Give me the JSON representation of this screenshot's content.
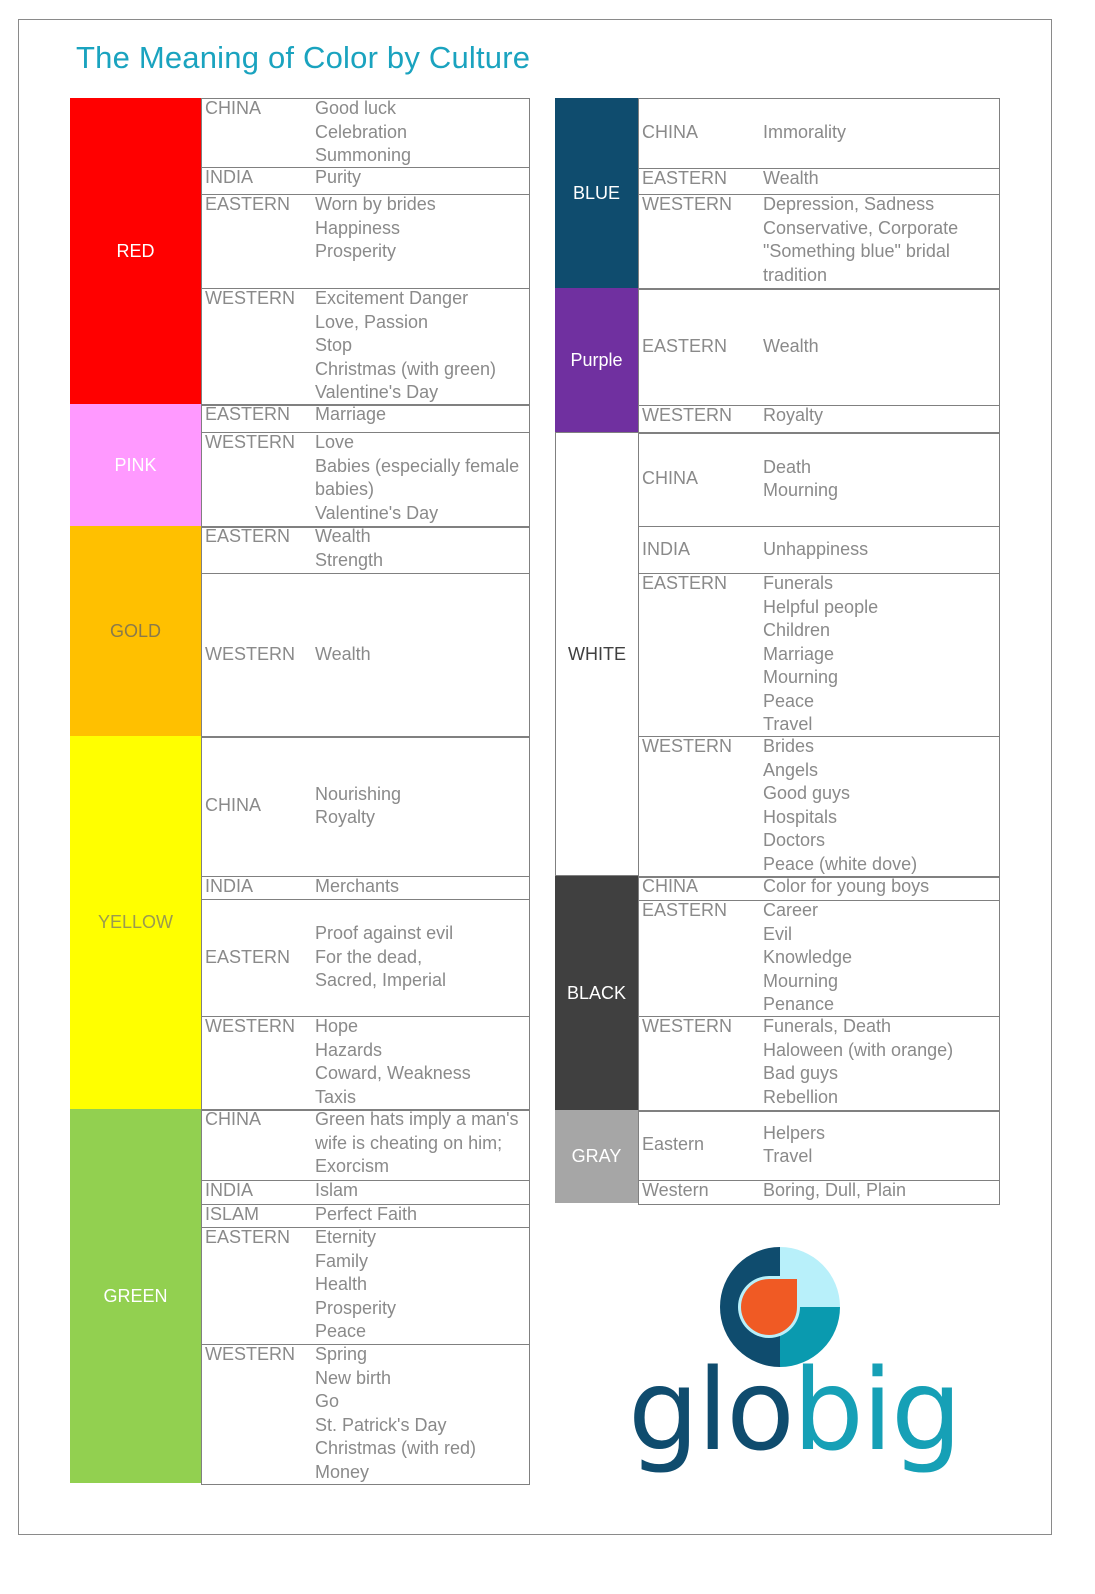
{
  "title": "The Meaning of Color by Culture",
  "colors": {
    "red": "#FF0000",
    "pink": "#FF99FF",
    "gold": "#FFC000",
    "yellow": "#FFFF00",
    "green": "#92D050",
    "blue": "#0F4C6E",
    "purple": "#7030A0",
    "white": "#FFFFFF",
    "black": "#404040",
    "gray": "#A6A6A6",
    "title": "#1AA3BF"
  },
  "left_table": [
    {
      "color": "RED",
      "rows": [
        {
          "region": "CHINA",
          "meanings": [
            "Good luck",
            "Celebration",
            "Summoning"
          ]
        },
        {
          "region": "INDIA",
          "meanings": [
            "Purity"
          ]
        },
        {
          "region": "EASTERN",
          "meanings": [
            "Worn by brides",
            "Happiness",
            "Prosperity"
          ]
        },
        {
          "region": "WESTERN",
          "meanings": [
            "Excitement Danger",
            "Love, Passion",
            "Stop",
            "Christmas (with green)",
            "Valentine's Day"
          ]
        }
      ]
    },
    {
      "color": "PINK",
      "rows": [
        {
          "region": "EASTERN",
          "meanings": [
            "Marriage"
          ]
        },
        {
          "region": "WESTERN",
          "meanings": [
            "Love",
            "Babies (especially female",
            "babies)",
            "Valentine's Day"
          ]
        }
      ]
    },
    {
      "color": "GOLD",
      "rows": [
        {
          "region": "EASTERN",
          "meanings": [
            "Wealth",
            "Strength"
          ]
        },
        {
          "region": "WESTERN",
          "meanings": [
            "Wealth"
          ]
        }
      ]
    },
    {
      "color": "YELLOW",
      "rows": [
        {
          "region": "CHINA",
          "meanings": [
            "Nourishing",
            "Royalty"
          ]
        },
        {
          "region": "INDIA",
          "meanings": [
            "Merchants"
          ]
        },
        {
          "region": "EASTERN",
          "meanings": [
            "Proof against evil",
            "For the dead,",
            "Sacred, Imperial"
          ]
        },
        {
          "region": "WESTERN",
          "meanings": [
            "Hope",
            "Hazards",
            "Coward, Weakness",
            "Taxis"
          ]
        }
      ]
    },
    {
      "color": "GREEN",
      "rows": [
        {
          "region": "CHINA",
          "meanings": [
            "Green hats imply a man's",
            "wife is cheating on him;",
            "Exorcism"
          ]
        },
        {
          "region": "INDIA",
          "meanings": [
            "Islam"
          ]
        },
        {
          "region": "ISLAM",
          "meanings": [
            "Perfect Faith"
          ]
        },
        {
          "region": "EASTERN",
          "meanings": [
            "Eternity",
            "Family",
            "Health",
            "Prosperity",
            "Peace"
          ]
        },
        {
          "region": "WESTERN",
          "meanings": [
            "Spring",
            "New birth",
            "Go",
            "St. Patrick's Day",
            "Christmas (with red)",
            "Money"
          ]
        }
      ]
    }
  ],
  "right_table": [
    {
      "color": "BLUE",
      "rows": [
        {
          "region": "CHINA",
          "meanings": [
            "Immorality"
          ]
        },
        {
          "region": "EASTERN",
          "meanings": [
            "Wealth"
          ]
        },
        {
          "region": "WESTERN",
          "meanings": [
            "Depression, Sadness",
            "Conservative, Corporate",
            "\"Something blue\" bridal",
            "tradition"
          ]
        }
      ]
    },
    {
      "color": "Purple",
      "rows": [
        {
          "region": "EASTERN",
          "meanings": [
            "Wealth"
          ]
        },
        {
          "region": "WESTERN",
          "meanings": [
            "Royalty"
          ]
        }
      ]
    },
    {
      "color": "WHITE",
      "rows": [
        {
          "region": "CHINA",
          "meanings": [
            "Death",
            "Mourning"
          ]
        },
        {
          "region": "INDIA",
          "meanings": [
            "Unhappiness"
          ]
        },
        {
          "region": "EASTERN",
          "meanings": [
            "Funerals",
            "Helpful people",
            "Children",
            "Marriage",
            "Mourning",
            "Peace",
            "Travel"
          ]
        },
        {
          "region": "WESTERN",
          "meanings": [
            "Brides",
            "Angels",
            "Good guys",
            "Hospitals",
            "Doctors",
            "Peace (white dove)"
          ]
        }
      ]
    },
    {
      "color": "BLACK",
      "rows": [
        {
          "region": "CHINA",
          "meanings": [
            "Color for young boys"
          ]
        },
        {
          "region": "EASTERN",
          "meanings": [
            "Career",
            "Evil",
            "Knowledge",
            "Mourning",
            "Penance"
          ]
        },
        {
          "region": "WESTERN",
          "meanings": [
            "Funerals, Death",
            "Haloween (with orange)",
            "Bad guys",
            "Rebellion"
          ]
        }
      ]
    },
    {
      "color": "GRAY",
      "rows": [
        {
          "region": "Eastern",
          "meanings": [
            "Helpers",
            "Travel"
          ]
        },
        {
          "region": "Western",
          "meanings": [
            "Boring, Dull, Plain"
          ]
        }
      ]
    }
  ],
  "logo": {
    "text_part1": "glo",
    "text_part2": "big",
    "colors": {
      "dark": "#0F4C6E",
      "teal": "#16A0B6",
      "light": "#B8F0FA",
      "orange": "#F05A24"
    }
  }
}
